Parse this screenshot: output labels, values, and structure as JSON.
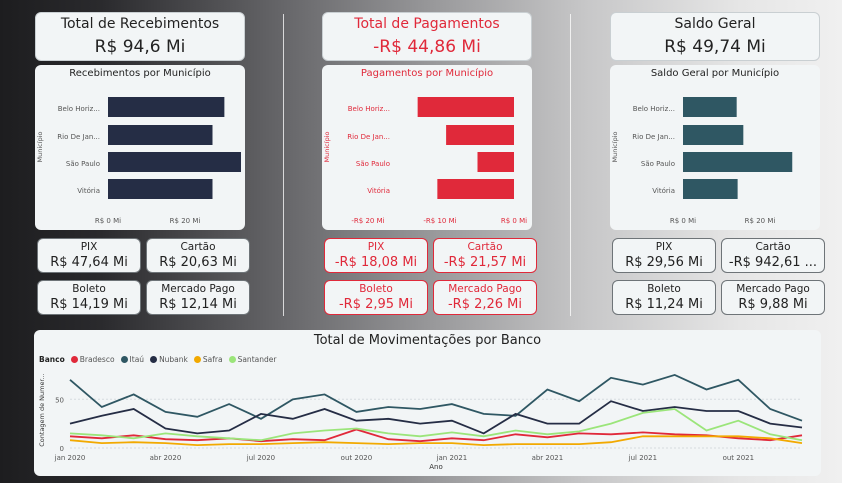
{
  "columns": [
    {
      "kpi_title": "Total de Recebimentos",
      "kpi_value": "R$ 94,6 Mi",
      "chart_title": "Recebimentos por Município",
      "axis_label": "Município",
      "color": "#252d45",
      "cards": [
        {
          "label": "PIX",
          "value": "R$ 47,64 Mi"
        },
        {
          "label": "Cartão",
          "value": "R$ 20,63 Mi"
        },
        {
          "label": "Boleto",
          "value": "R$ 14,19 Mi"
        },
        {
          "label": "Mercado Pago",
          "value": "R$ 12,14 Mi"
        }
      ]
    },
    {
      "kpi_title": "Total de Pagamentos",
      "kpi_value": "-R$ 44,86 Mi",
      "chart_title": "Pagamentos por Município",
      "axis_label": "Município",
      "color": "#e0293a",
      "cards": [
        {
          "label": "PIX",
          "value": "-R$ 18,08 Mi"
        },
        {
          "label": "Cartão",
          "value": "-R$ 21,57 Mi"
        },
        {
          "label": "Boleto",
          "value": "-R$ 2,95 Mi"
        },
        {
          "label": "Mercado Pago",
          "value": "-R$ 2,26 Mi"
        }
      ]
    },
    {
      "kpi_title": "Saldo Geral",
      "kpi_value": "R$ 49,74 Mi",
      "chart_title": "Saldo Geral por Município",
      "axis_label": "Município",
      "color": "#2f5763",
      "cards": [
        {
          "label": "PIX",
          "value": "R$ 29,56 Mi"
        },
        {
          "label": "Cartão",
          "value": "-R$ 942,61 ..."
        },
        {
          "label": "Boleto",
          "value": "R$ 11,24 Mi"
        },
        {
          "label": "Mercado Pago",
          "value": "R$ 9,88 Mi"
        }
      ]
    }
  ],
  "line_title": "Total de Movimentações por Banco",
  "legend_title": "Banco",
  "chart_data": [
    {
      "type": "bar",
      "title": "Recebimentos por Município",
      "ylabel": "Município",
      "categories": [
        "Belo Horiz...",
        "Rio De Jan...",
        "São Paulo",
        "Vitória"
      ],
      "values": [
        24.5,
        22,
        28,
        22
      ],
      "xlim": [
        0,
        20
      ],
      "xticks": [
        "R$ 0 Mi",
        "R$ 20 Mi"
      ]
    },
    {
      "type": "bar",
      "title": "Pagamentos por Município",
      "ylabel": "Município",
      "categories": [
        "Belo Horiz...",
        "Rio De Jan...",
        "São Paulo",
        "Vitória"
      ],
      "values": [
        -13.2,
        -9.3,
        -5,
        -10.5
      ],
      "xlim": [
        -20,
        0
      ],
      "xticks": [
        "-R$ 20 Mi",
        "-R$ 10 Mi",
        "R$ 0 Mi"
      ]
    },
    {
      "type": "bar",
      "title": "Saldo Geral por Município",
      "ylabel": "Município",
      "categories": [
        "Belo Horiz...",
        "Rio De Jan...",
        "São Paulo",
        "Vitória"
      ],
      "values": [
        11.3,
        12.7,
        23,
        11.5
      ],
      "xlim": [
        0,
        20
      ],
      "xticks": [
        "R$ 0 Mi",
        "R$ 20 Mi"
      ]
    },
    {
      "type": "line",
      "title": "Total de Movimentações por Banco",
      "xlabel": "Ano",
      "ylabel": "Contagem de Numer...",
      "ylim": [
        0,
        80
      ],
      "yticks": [
        0,
        50
      ],
      "x": [
        "jan 2020",
        "fev 2020",
        "mar 2020",
        "abr 2020",
        "mai 2020",
        "jun 2020",
        "jul 2020",
        "ago 2020",
        "set 2020",
        "out 2020",
        "nov 2020",
        "dez 2020",
        "jan 2021",
        "fev 2021",
        "mar 2021",
        "abr 2021",
        "mai 2021",
        "jun 2021",
        "jul 2021",
        "ago 2021",
        "set 2021",
        "out 2021",
        "nov 2021",
        "dez 2021"
      ],
      "xticks": [
        "jan 2020",
        "abr 2020",
        "jul 2020",
        "out 2020",
        "jan 2021",
        "abr 2021",
        "jul 2021",
        "out 2021"
      ],
      "series": [
        {
          "name": "Bradesco",
          "color": "#e0293a",
          "values": [
            12,
            10,
            13,
            9,
            8,
            10,
            7,
            9,
            8,
            19,
            9,
            7,
            10,
            8,
            14,
            11,
            15,
            14,
            16,
            14,
            13,
            10,
            8,
            13
          ]
        },
        {
          "name": "Itaú",
          "color": "#2f5763",
          "values": [
            70,
            42,
            55,
            37,
            32,
            45,
            30,
            50,
            55,
            37,
            42,
            40,
            45,
            35,
            33,
            60,
            48,
            72,
            65,
            75,
            60,
            70,
            40,
            28
          ]
        },
        {
          "name": "Nubank",
          "color": "#252d45",
          "values": [
            25,
            33,
            40,
            20,
            15,
            18,
            35,
            30,
            40,
            28,
            30,
            25,
            28,
            15,
            35,
            25,
            25,
            48,
            38,
            42,
            38,
            38,
            25,
            21
          ]
        },
        {
          "name": "Safra",
          "color": "#f2a900",
          "values": [
            8,
            5,
            6,
            5,
            3,
            4,
            4,
            5,
            6,
            5,
            4,
            5,
            5,
            3,
            4,
            4,
            4,
            6,
            12,
            12,
            12,
            12,
            10,
            5
          ]
        },
        {
          "name": "Santander",
          "color": "#9be57a",
          "values": [
            15,
            13,
            10,
            15,
            12,
            10,
            8,
            15,
            18,
            20,
            15,
            12,
            16,
            12,
            18,
            14,
            17,
            25,
            36,
            40,
            18,
            28,
            14,
            8
          ]
        }
      ]
    }
  ]
}
